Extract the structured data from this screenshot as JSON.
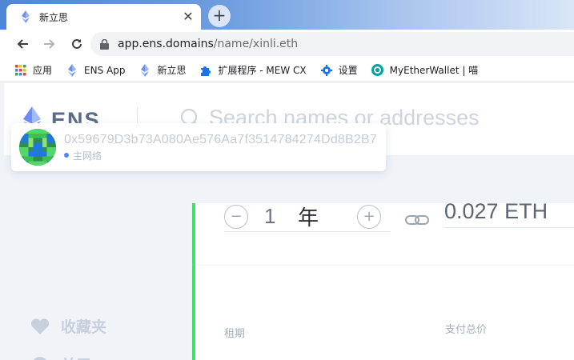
{
  "browser": {
    "tab": {
      "title": "新立思",
      "close": "✕"
    },
    "new_tab": "+",
    "url": {
      "host": "app.ens.domains",
      "path": "/name/xinli.eth"
    },
    "bookmarks": [
      {
        "label": "应用",
        "icon": "apps-grid-icon"
      },
      {
        "label": "ENS App",
        "icon": "ens-icon"
      },
      {
        "label": "新立思",
        "icon": "ens-icon"
      },
      {
        "label": "扩展程序 - MEW CX",
        "icon": "puzzle-icon"
      },
      {
        "label": "设置",
        "icon": "gear-icon"
      },
      {
        "label": "MyEtherWallet | 喵",
        "icon": "mew-icon"
      }
    ]
  },
  "ens": {
    "logo": "ENS",
    "search_placeholder": "Search names or addresses",
    "account": {
      "address": "0x59679D3b73A080Ae576Aa7f3514784274Dd8B2B7",
      "network": "主网络"
    },
    "sidebar": [
      {
        "label": "收藏夹",
        "icon": "heart-icon"
      },
      {
        "label": "关于",
        "icon": "info-icon"
      }
    ],
    "registration": {
      "years": "1",
      "unit": "年",
      "minus": "−",
      "plus": "+",
      "years_label": "租期",
      "price": "0.027 ETH",
      "price_label": "支付总价"
    }
  },
  "colors": {
    "accent_green": "#42e068",
    "network_dot": "#5284ff",
    "ens_logo": "#5a6b88"
  }
}
